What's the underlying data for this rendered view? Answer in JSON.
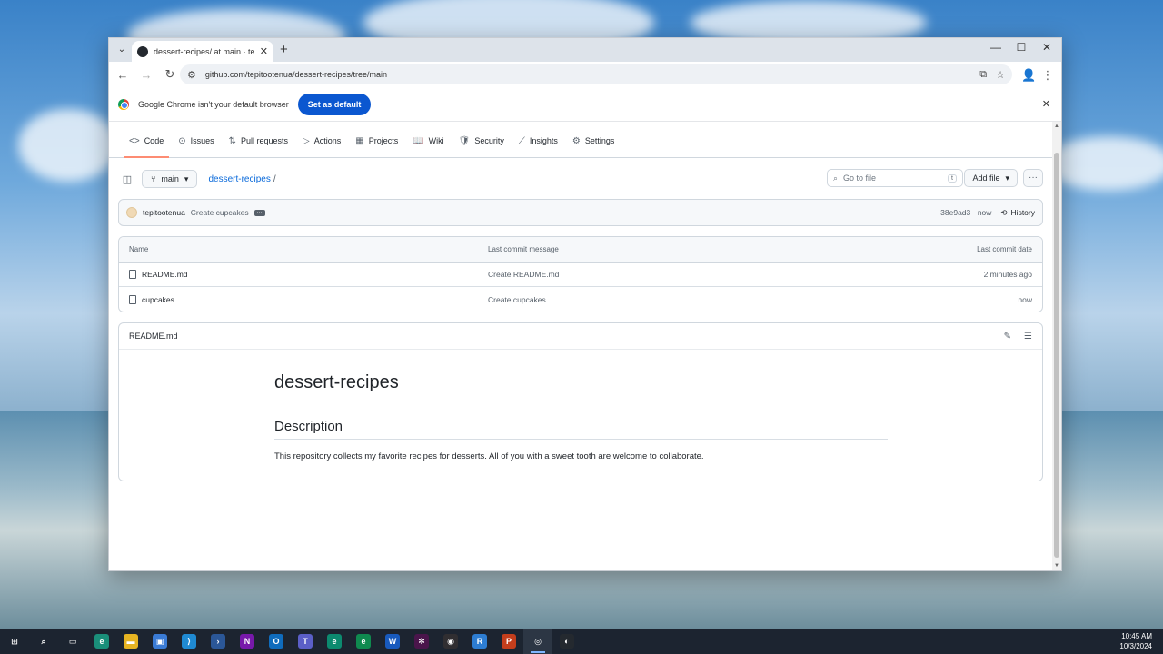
{
  "browser": {
    "tab_title": "dessert-recipes/ at main · tepit...",
    "new_tab": "+",
    "url": "github.com/tepitootenua/dessert-recipes/tree/main",
    "infobar_text": "Google Chrome isn't your default browser",
    "set_default_label": "Set as default",
    "controls": {
      "minimize": "—",
      "maximize": "☐",
      "close": "✕"
    }
  },
  "repo_nav": [
    {
      "label": "Code",
      "icon": "<>"
    },
    {
      "label": "Issues",
      "icon": "⊙"
    },
    {
      "label": "Pull requests",
      "icon": "⇅"
    },
    {
      "label": "Actions",
      "icon": "▷"
    },
    {
      "label": "Projects",
      "icon": "▦"
    },
    {
      "label": "Wiki",
      "icon": "📖"
    },
    {
      "label": "Security",
      "icon": "🛡"
    },
    {
      "label": "Insights",
      "icon": "⟋"
    },
    {
      "label": "Settings",
      "icon": "⚙"
    }
  ],
  "filebar": {
    "branch": "main",
    "crumb": "dessert-recipes",
    "crumb_sep": "/",
    "goto_placeholder": "Go to file",
    "goto_kbd": "t",
    "add_file": "Add file",
    "more": "···"
  },
  "commit": {
    "author": "tepitootenua",
    "message": "Create cupcakes",
    "dots": "···",
    "sha": "38e9ad3 · now",
    "history": "History"
  },
  "files": {
    "headers": {
      "name": "Name",
      "msg": "Last commit message",
      "date": "Last commit date"
    },
    "rows": [
      {
        "name": "README.md",
        "msg": "Create README.md",
        "date": "2 minutes ago"
      },
      {
        "name": "cupcakes",
        "msg": "Create cupcakes",
        "date": "now"
      }
    ]
  },
  "readme": {
    "title": "README.md",
    "h1": "dessert-recipes",
    "h2": "Description",
    "p": "This repository collects my favorite recipes for desserts. All of you with a sweet tooth are welcome to collaborate."
  },
  "taskbar": {
    "apps": [
      {
        "name": "start",
        "glyph": "⊞",
        "color": "#1c2430"
      },
      {
        "name": "search",
        "glyph": "⌕",
        "color": "#1c2430"
      },
      {
        "name": "task-view",
        "glyph": "▭",
        "color": "#1c2430"
      },
      {
        "name": "edge",
        "glyph": "e",
        "color": "#1a8f7a"
      },
      {
        "name": "file-explorer",
        "glyph": "▬",
        "color": "#e6b422"
      },
      {
        "name": "store",
        "glyph": "▣",
        "color": "#3a7bd5"
      },
      {
        "name": "vscode",
        "glyph": "⟩",
        "color": "#1f8ad2"
      },
      {
        "name": "powershell",
        "glyph": "›",
        "color": "#2b5797"
      },
      {
        "name": "onenote",
        "glyph": "N",
        "color": "#7719aa"
      },
      {
        "name": "outlook",
        "glyph": "O",
        "color": "#0f6cbd"
      },
      {
        "name": "teams",
        "glyph": "T",
        "color": "#5b5fc7"
      },
      {
        "name": "edge-beta",
        "glyph": "e",
        "color": "#0c8a6f"
      },
      {
        "name": "edge-dev",
        "glyph": "e",
        "color": "#0f8a4f"
      },
      {
        "name": "word",
        "glyph": "W",
        "color": "#185abd"
      },
      {
        "name": "slack",
        "glyph": "✻",
        "color": "#4a154b"
      },
      {
        "name": "obs",
        "glyph": "◉",
        "color": "#302e31"
      },
      {
        "name": "remote",
        "glyph": "R",
        "color": "#2d7dd2"
      },
      {
        "name": "powerpoint",
        "glyph": "P",
        "color": "#c43e1c"
      },
      {
        "name": "chrome",
        "glyph": "◎",
        "color": "#2c3644",
        "active": true
      },
      {
        "name": "github-desktop",
        "glyph": "◐",
        "color": "#24292f"
      }
    ],
    "time": "10:45 AM",
    "date": "10/3/2024"
  },
  "colors": {
    "accent": "#0969da",
    "underline": "#fd8c73",
    "chrome_blue": "#0b57d0"
  }
}
